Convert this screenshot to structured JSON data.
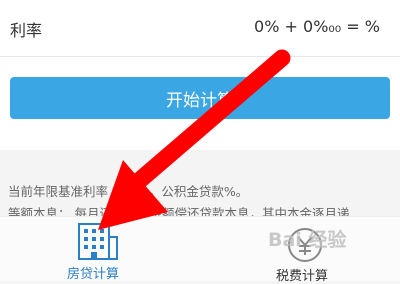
{
  "rate": {
    "label": "利率",
    "value": "0% + 0%₀₀ = %"
  },
  "actions": {
    "start_label": "开始计算"
  },
  "notes": {
    "line1": "当前年限基准利率  贷款%，公积金贷款%。",
    "line2": "等额本息： 每月还相等的金额偿还贷款本息，其中本金逐月递"
  },
  "tabs": [
    {
      "label": "房贷计算",
      "icon": "building-icon",
      "active": true
    },
    {
      "label": "税费计算",
      "icon": "coin-icon",
      "active": false
    }
  ],
  "watermark": "Bai 经验",
  "colors": {
    "accent": "#3aa6e4",
    "active_tab": "#2b7fc6",
    "arrow": "#ff0000"
  }
}
